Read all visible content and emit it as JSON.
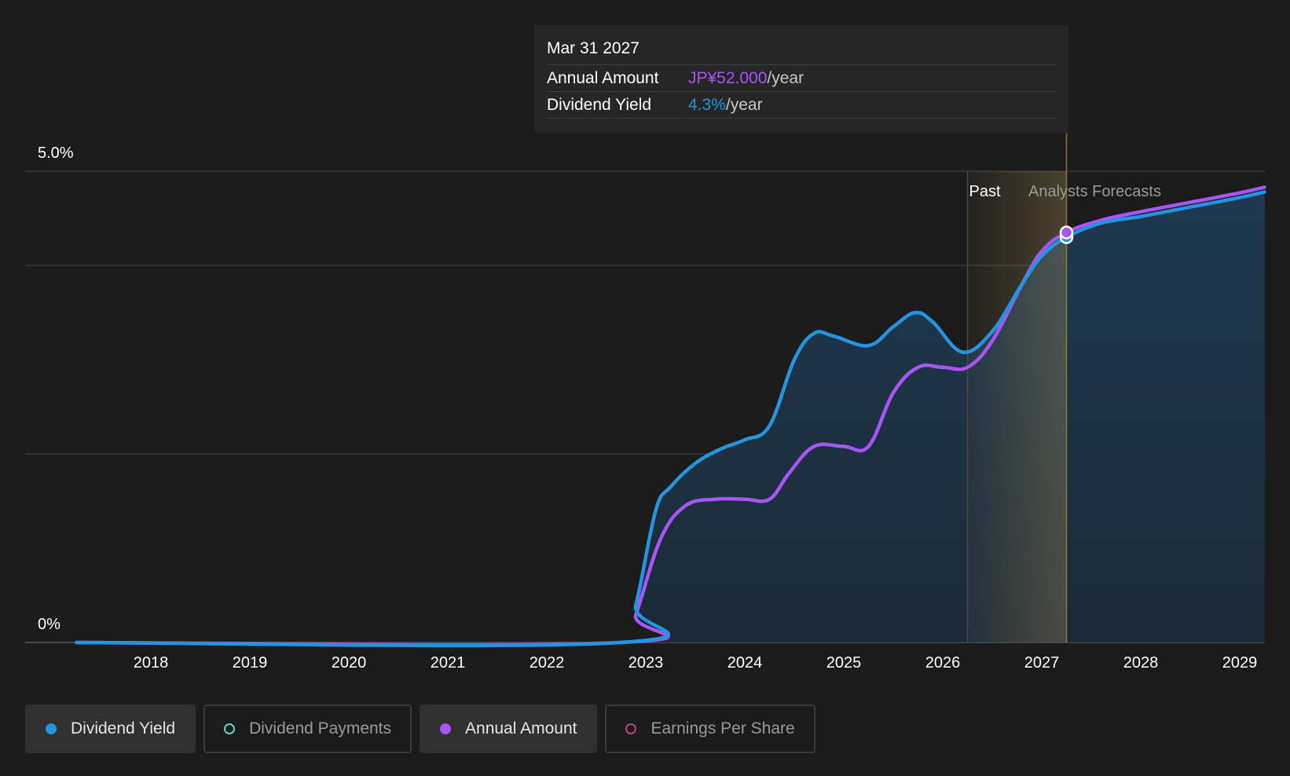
{
  "colors": {
    "background": "#1b1b1b",
    "dividend_yield": "#2394df",
    "annual_amount": "#a855f7",
    "dividend_payments": "#6ad3bd",
    "earnings_per_share": "#c0437c",
    "forecast_highlight": "#c4a25a"
  },
  "tooltip": {
    "date": "Mar 31 2027",
    "rows": [
      {
        "label": "Annual Amount",
        "value": "JP¥52.000",
        "unit": "/year"
      },
      {
        "label": "Dividend Yield",
        "value": "4.3%",
        "unit": "/year"
      }
    ]
  },
  "region_labels": {
    "past": "Past",
    "forecast": "Analysts Forecasts"
  },
  "legend": [
    {
      "label": "Dividend Yield",
      "state": "active",
      "dot": "filled",
      "color": "#2394df"
    },
    {
      "label": "Dividend Payments",
      "state": "inactive",
      "dot": "hollow",
      "color": "#6ad3bd"
    },
    {
      "label": "Annual Amount",
      "state": "active",
      "dot": "filled",
      "color": "#a855f7"
    },
    {
      "label": "Earnings Per Share",
      "state": "inactive",
      "dot": "hollow",
      "color": "#c0437c"
    }
  ],
  "chart_data": {
    "type": "line",
    "ylim": [
      0,
      5.0
    ],
    "y_tick_labels": [
      "5.0%",
      "0%"
    ],
    "x_tick_labels": [
      "2018",
      "2019",
      "2020",
      "2021",
      "2022",
      "2023",
      "2024",
      "2025",
      "2026",
      "2027",
      "2028",
      "2029"
    ],
    "x_tick_years": [
      2018,
      2019,
      2020,
      2021,
      2022,
      2023,
      2024,
      2025,
      2026,
      2027,
      2028,
      2029
    ],
    "gridlines_pct": [
      5.0,
      4.0,
      2.0,
      0
    ],
    "past_end_year": 2026.25,
    "tooltip_year": 2027.25,
    "grid": true,
    "series": [
      {
        "name": "Dividend Yield",
        "unit": "%",
        "points": [
          [
            2017.25,
            0
          ],
          [
            2022.75,
            0
          ],
          [
            2022.9,
            0.4
          ],
          [
            2023.1,
            1.4
          ],
          [
            2023.25,
            1.65
          ],
          [
            2023.5,
            1.9
          ],
          [
            2023.75,
            2.05
          ],
          [
            2024.0,
            2.15
          ],
          [
            2024.25,
            2.3
          ],
          [
            2024.5,
            3.0
          ],
          [
            2024.7,
            3.28
          ],
          [
            2024.9,
            3.25
          ],
          [
            2025.25,
            3.15
          ],
          [
            2025.5,
            3.35
          ],
          [
            2025.72,
            3.5
          ],
          [
            2025.9,
            3.4
          ],
          [
            2026.2,
            3.08
          ],
          [
            2026.5,
            3.3
          ],
          [
            2026.8,
            3.8
          ],
          [
            2027.0,
            4.1
          ],
          [
            2027.25,
            4.3
          ],
          [
            2027.6,
            4.45
          ],
          [
            2028.0,
            4.52
          ],
          [
            2028.5,
            4.62
          ],
          [
            2029.0,
            4.72
          ],
          [
            2029.25,
            4.78
          ]
        ]
      },
      {
        "name": "Annual Amount",
        "unit": "JP¥",
        "points": [
          [
            2017.25,
            0
          ],
          [
            2022.75,
            0
          ],
          [
            2022.9,
            0.3
          ],
          [
            2023.15,
            1.1
          ],
          [
            2023.4,
            1.45
          ],
          [
            2023.7,
            1.52
          ],
          [
            2024.0,
            1.52
          ],
          [
            2024.25,
            1.52
          ],
          [
            2024.45,
            1.8
          ],
          [
            2024.7,
            2.08
          ],
          [
            2025.0,
            2.08
          ],
          [
            2025.25,
            2.08
          ],
          [
            2025.5,
            2.65
          ],
          [
            2025.75,
            2.92
          ],
          [
            2026.0,
            2.92
          ],
          [
            2026.25,
            2.92
          ],
          [
            2026.5,
            3.2
          ],
          [
            2026.8,
            3.8
          ],
          [
            2027.0,
            4.15
          ],
          [
            2027.25,
            4.35
          ],
          [
            2027.6,
            4.48
          ],
          [
            2028.0,
            4.57
          ],
          [
            2028.5,
            4.67
          ],
          [
            2029.0,
            4.77
          ],
          [
            2029.25,
            4.83
          ]
        ]
      }
    ]
  }
}
